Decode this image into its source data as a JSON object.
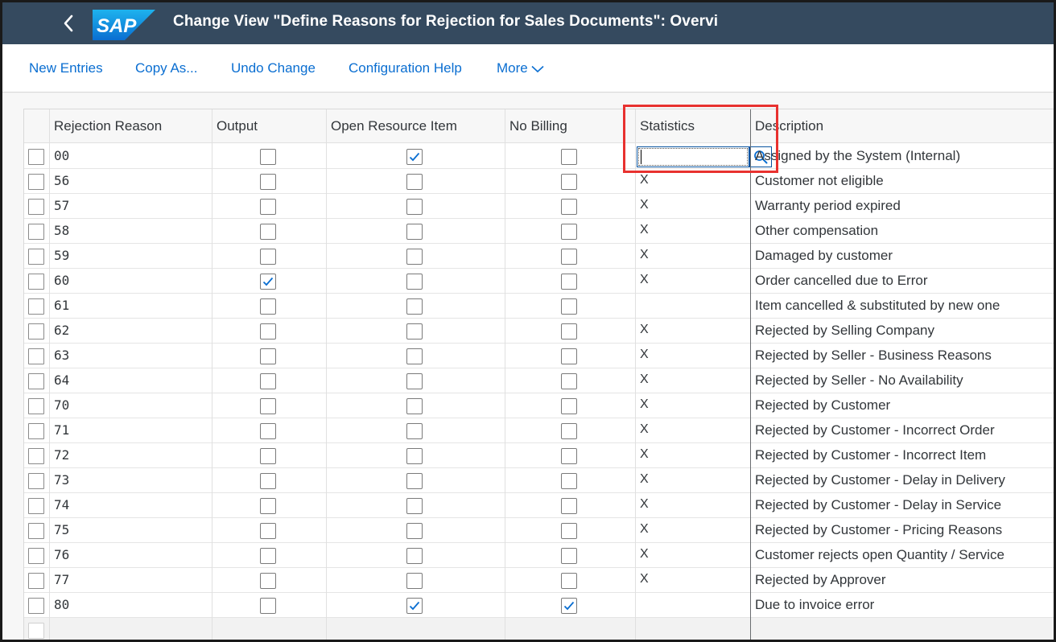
{
  "window": {
    "title": "Change View \"Define Reasons for Rejection for Sales Documents\": Overvi",
    "brand_color": "#354a5f",
    "accent_color": "#0a6ed1",
    "logo_text": "SAP",
    "back_icon": "chevron-left-icon"
  },
  "toolbar": {
    "new_entries": "New Entries",
    "copy_as": "Copy As...",
    "undo_change": "Undo Change",
    "configuration_help": "Configuration Help",
    "more": "More"
  },
  "table": {
    "columns": [
      "Rejection Reason",
      "Output",
      "Open Resource Item",
      "No Billing",
      "Statistics",
      "Description"
    ],
    "rows": [
      {
        "code": "00",
        "output": false,
        "open_resource": true,
        "no_billing": false,
        "statistics": "",
        "description": "Assigned by the System (Internal)",
        "editing": true
      },
      {
        "code": "56",
        "output": false,
        "open_resource": false,
        "no_billing": false,
        "statistics": "X",
        "description": "Customer not eligible"
      },
      {
        "code": "57",
        "output": false,
        "open_resource": false,
        "no_billing": false,
        "statistics": "X",
        "description": "Warranty period expired"
      },
      {
        "code": "58",
        "output": false,
        "open_resource": false,
        "no_billing": false,
        "statistics": "X",
        "description": "Other compensation"
      },
      {
        "code": "59",
        "output": false,
        "open_resource": false,
        "no_billing": false,
        "statistics": "X",
        "description": "Damaged by customer"
      },
      {
        "code": "60",
        "output": true,
        "open_resource": false,
        "no_billing": false,
        "statistics": "X",
        "description": "Order cancelled due to Error"
      },
      {
        "code": "61",
        "output": false,
        "open_resource": false,
        "no_billing": false,
        "statistics": "",
        "description": "Item cancelled & substituted by new one"
      },
      {
        "code": "62",
        "output": false,
        "open_resource": false,
        "no_billing": false,
        "statistics": "X",
        "description": "Rejected by Selling Company"
      },
      {
        "code": "63",
        "output": false,
        "open_resource": false,
        "no_billing": false,
        "statistics": "X",
        "description": "Rejected by Seller - Business Reasons"
      },
      {
        "code": "64",
        "output": false,
        "open_resource": false,
        "no_billing": false,
        "statistics": "X",
        "description": "Rejected by Seller - No Availability"
      },
      {
        "code": "70",
        "output": false,
        "open_resource": false,
        "no_billing": false,
        "statistics": "X",
        "description": "Rejected by Customer"
      },
      {
        "code": "71",
        "output": false,
        "open_resource": false,
        "no_billing": false,
        "statistics": "X",
        "description": "Rejected by Customer - Incorrect Order"
      },
      {
        "code": "72",
        "output": false,
        "open_resource": false,
        "no_billing": false,
        "statistics": "X",
        "description": "Rejected by Customer - Incorrect Item"
      },
      {
        "code": "73",
        "output": false,
        "open_resource": false,
        "no_billing": false,
        "statistics": "X",
        "description": "Rejected by Customer - Delay in Delivery"
      },
      {
        "code": "74",
        "output": false,
        "open_resource": false,
        "no_billing": false,
        "statistics": "X",
        "description": "Rejected by Customer - Delay in Service"
      },
      {
        "code": "75",
        "output": false,
        "open_resource": false,
        "no_billing": false,
        "statistics": "X",
        "description": "Rejected by Customer - Pricing Reasons"
      },
      {
        "code": "76",
        "output": false,
        "open_resource": false,
        "no_billing": false,
        "statistics": "X",
        "description": "Customer rejects open Quantity / Service"
      },
      {
        "code": "77",
        "output": false,
        "open_resource": false,
        "no_billing": false,
        "statistics": "X",
        "description": "Rejected by Approver"
      },
      {
        "code": "80",
        "output": false,
        "open_resource": true,
        "no_billing": true,
        "statistics": "",
        "description": "Due to invoice error"
      }
    ]
  },
  "icons": {
    "value_help": "search-icon",
    "more_menu": "chevron-down-icon",
    "checkmark": "checkmark-icon"
  },
  "highlight_color": "#e8312f"
}
